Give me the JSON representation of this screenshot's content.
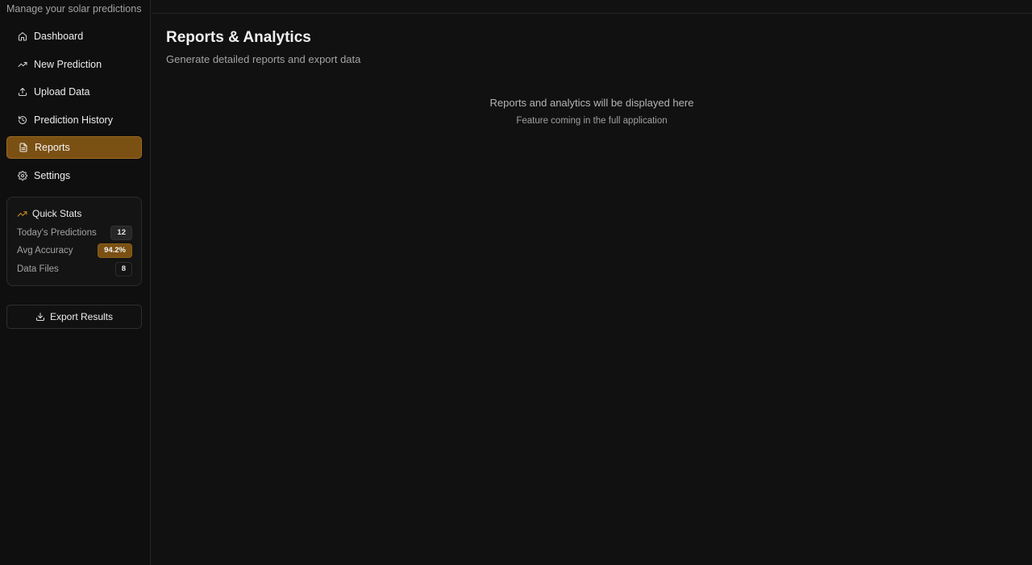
{
  "sidebar": {
    "subtitle": "Manage your solar predictions",
    "nav": [
      {
        "label": "Dashboard",
        "icon": "home-icon"
      },
      {
        "label": "New Prediction",
        "icon": "trending-up-icon"
      },
      {
        "label": "Upload Data",
        "icon": "upload-icon"
      },
      {
        "label": "Prediction History",
        "icon": "history-icon"
      },
      {
        "label": "Reports",
        "icon": "file-text-icon",
        "active": true
      },
      {
        "label": "Settings",
        "icon": "gear-icon"
      }
    ],
    "quick_stats": {
      "title": "Quick Stats",
      "icon": "trending-up-icon",
      "rows": [
        {
          "label": "Today's Predictions",
          "value": "12"
        },
        {
          "label": "Avg Accuracy",
          "value": "94.2%"
        },
        {
          "label": "Data Files",
          "value": "8"
        }
      ]
    },
    "export_label": "Export Results"
  },
  "main": {
    "title": "Reports & Analytics",
    "subtitle": "Generate detailed reports and export data",
    "placeholder_text": "Reports and analytics will be displayed here",
    "placeholder_subtext": "Feature coming in the full application"
  },
  "colors": {
    "background": "#111111",
    "accent": "#7a5013",
    "border": "#262626"
  }
}
